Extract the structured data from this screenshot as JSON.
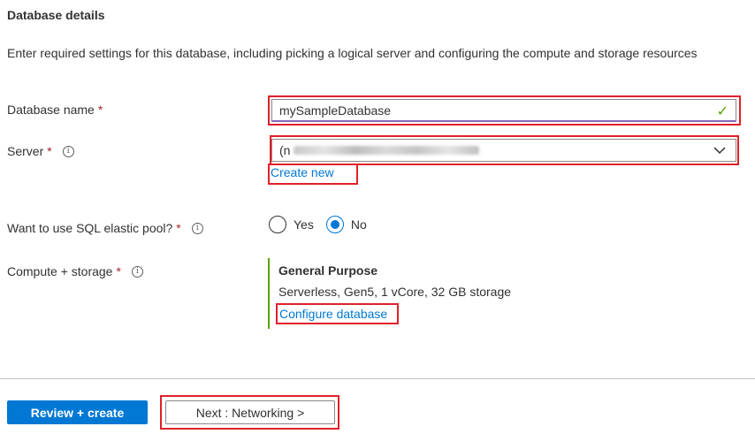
{
  "section": {
    "title": "Database details",
    "description": "Enter required settings for this database, including picking a logical server and configuring the compute and storage resources"
  },
  "fields": {
    "database_name": {
      "label": "Database name",
      "required": "*",
      "value": "mySampleDatabase"
    },
    "server": {
      "label": "Server",
      "required": "*",
      "info": "i",
      "value_prefix": "(n",
      "create_new": "Create new"
    },
    "elastic_pool": {
      "label": "Want to use SQL elastic pool?",
      "required": "*",
      "info": "i",
      "options": [
        "Yes",
        "No"
      ],
      "selected": "No"
    },
    "compute": {
      "label": "Compute + storage",
      "required": "*",
      "info": "i",
      "tier": "General Purpose",
      "details": "Serverless, Gen5, 1 vCore, 32 GB storage",
      "configure_link": "Configure database"
    }
  },
  "footer": {
    "review_button": "Review + create",
    "next_button": "Next : Networking >"
  },
  "colors": {
    "accent": "#0078d4",
    "highlight": "#e0202a",
    "valid": "#57a300"
  },
  "icons": [
    "check-icon",
    "info-icon",
    "chevron-down-icon"
  ]
}
